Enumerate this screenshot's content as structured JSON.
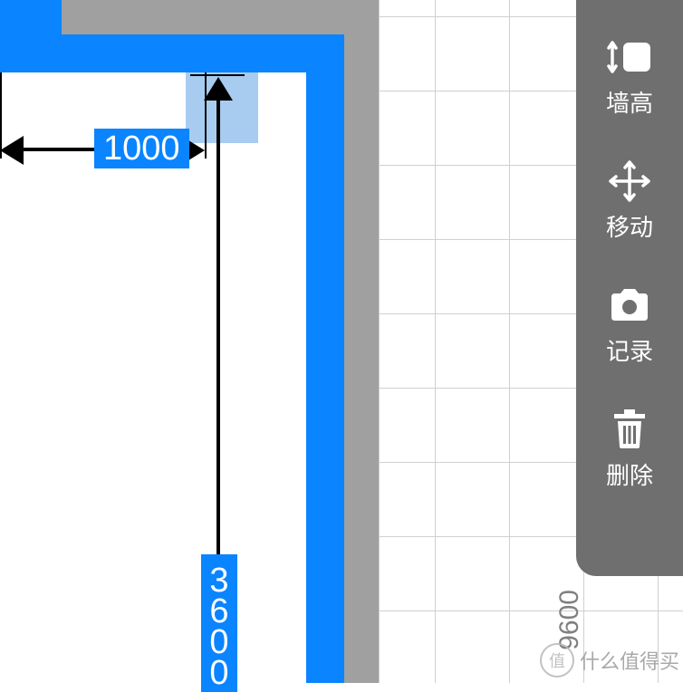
{
  "dimensions": {
    "horizontal": "1000",
    "vertical": "3600",
    "grid_side": "9600"
  },
  "toolbar": {
    "wall_height": {
      "label": "墙高"
    },
    "move": {
      "label": "移动"
    },
    "record": {
      "label": "记录"
    },
    "delete": {
      "label": "删除"
    }
  },
  "watermark": {
    "badge": "值",
    "text": "什么值得买"
  },
  "colors": {
    "wall_blue": "#0a84ff",
    "selected_blue": "#a8ccf0",
    "outer_gray": "#a0a0a0",
    "toolbar_gray": "#6f6f6f"
  }
}
